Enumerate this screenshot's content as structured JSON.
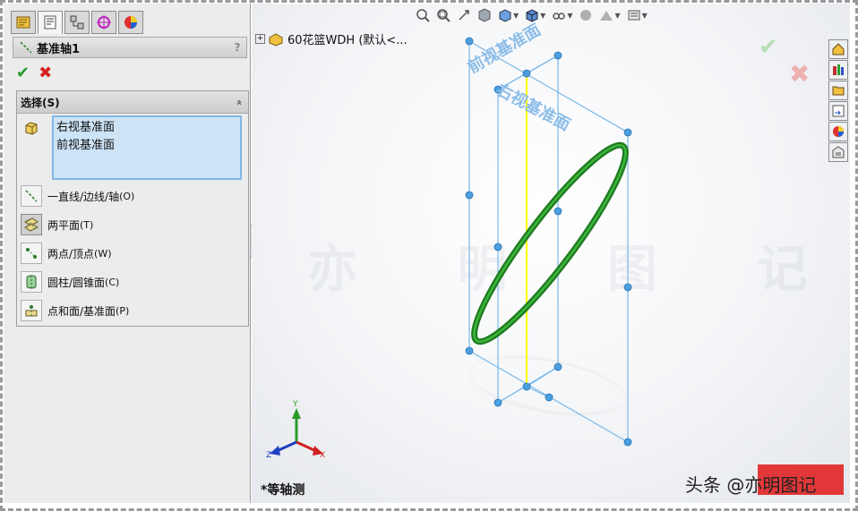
{
  "panel": {
    "tabs": [
      "feature-manager-icon",
      "property-manager-icon",
      "configuration-manager-icon",
      "dimxpert-icon",
      "display-manager-icon"
    ],
    "title": "基准轴1",
    "help": "?",
    "ok_symbol": "✔",
    "cancel_symbol": "✖",
    "selection_group": {
      "title": "选择(S)",
      "collapse": "«",
      "selected_items": [
        "右视基准面",
        "前视基准面"
      ],
      "options": [
        {
          "label": "一直线/边线/轴",
          "key": "(O)",
          "pressed": false
        },
        {
          "label": "两平面",
          "key": "(T)",
          "pressed": true
        },
        {
          "label": "两点/顶点",
          "key": "(W)",
          "pressed": false
        },
        {
          "label": "圆柱/圆锥面",
          "key": "(C)",
          "pressed": false
        },
        {
          "label": "点和面/基准面",
          "key": "(P)",
          "pressed": false
        }
      ]
    }
  },
  "viewport": {
    "tree_title": "60花篮WDH  (默认<...",
    "plane_labels": [
      "前视基准面",
      "右视基准面"
    ],
    "view_name": "*等轴测",
    "triad": {
      "y": "Y",
      "x": "X",
      "z": "Z"
    },
    "colors": {
      "plane": "#7ab8e8",
      "ring": "#1f8a1f",
      "axis": "#ffff00",
      "accent_green": "#2a9a2a",
      "accent_red": "#d42222"
    }
  },
  "watermark": "亦 明 图 记",
  "brand": "头条 @亦明图记"
}
